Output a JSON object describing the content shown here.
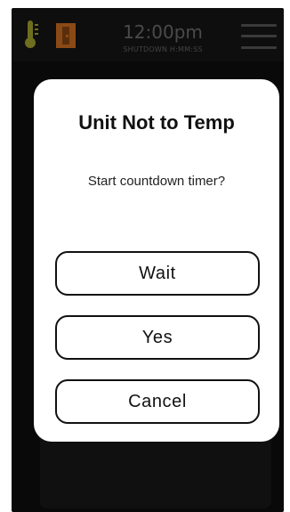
{
  "status_bar": {
    "time": "12:00pm",
    "shutdown_label": "SHUTDOWN H:MM:SS",
    "icons": [
      "thermometer-icon",
      "door-icon",
      "hamburger-menu-icon"
    ],
    "colors": {
      "thermometer": "#6e6e1e",
      "door": "#8a4a16"
    }
  },
  "modal": {
    "title": "Unit Not to Temp",
    "message": "Start countdown timer?",
    "buttons": {
      "wait": "Wait",
      "yes": "Yes",
      "cancel": "Cancel"
    }
  }
}
